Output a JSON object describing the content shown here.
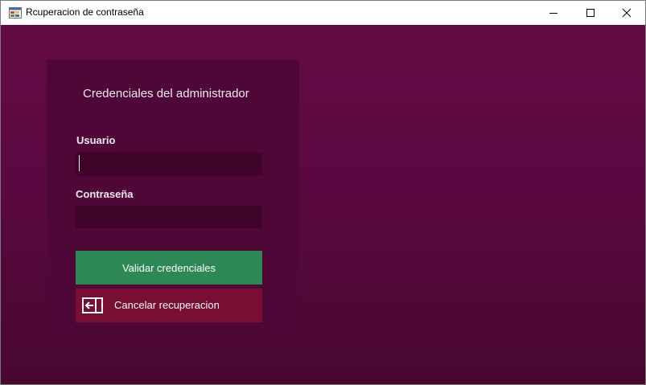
{
  "window": {
    "title": "Rcuperacion de contraseña",
    "app_icon": "winforms-app-icon",
    "controls": {
      "minimize_icon": "minimize-icon",
      "maximize_icon": "maximize-icon",
      "close_icon": "close-icon"
    }
  },
  "colors": {
    "background_top": "#650a45",
    "background_bottom": "#47072f",
    "panel": "#4e0737",
    "input_bg": "#3f032a",
    "validate_button": "#2e8b57",
    "cancel_button": "#7a0f34"
  },
  "form": {
    "heading": "Credenciales del administrador",
    "username": {
      "label": "Usuario",
      "value": "",
      "placeholder": ""
    },
    "password": {
      "label": "Contraseña",
      "value": "",
      "placeholder": ""
    },
    "validate_button": {
      "label": "Validar credenciales"
    },
    "cancel_button": {
      "label": "Cancelar recuperacion",
      "icon": "back-arrow-icon"
    }
  }
}
